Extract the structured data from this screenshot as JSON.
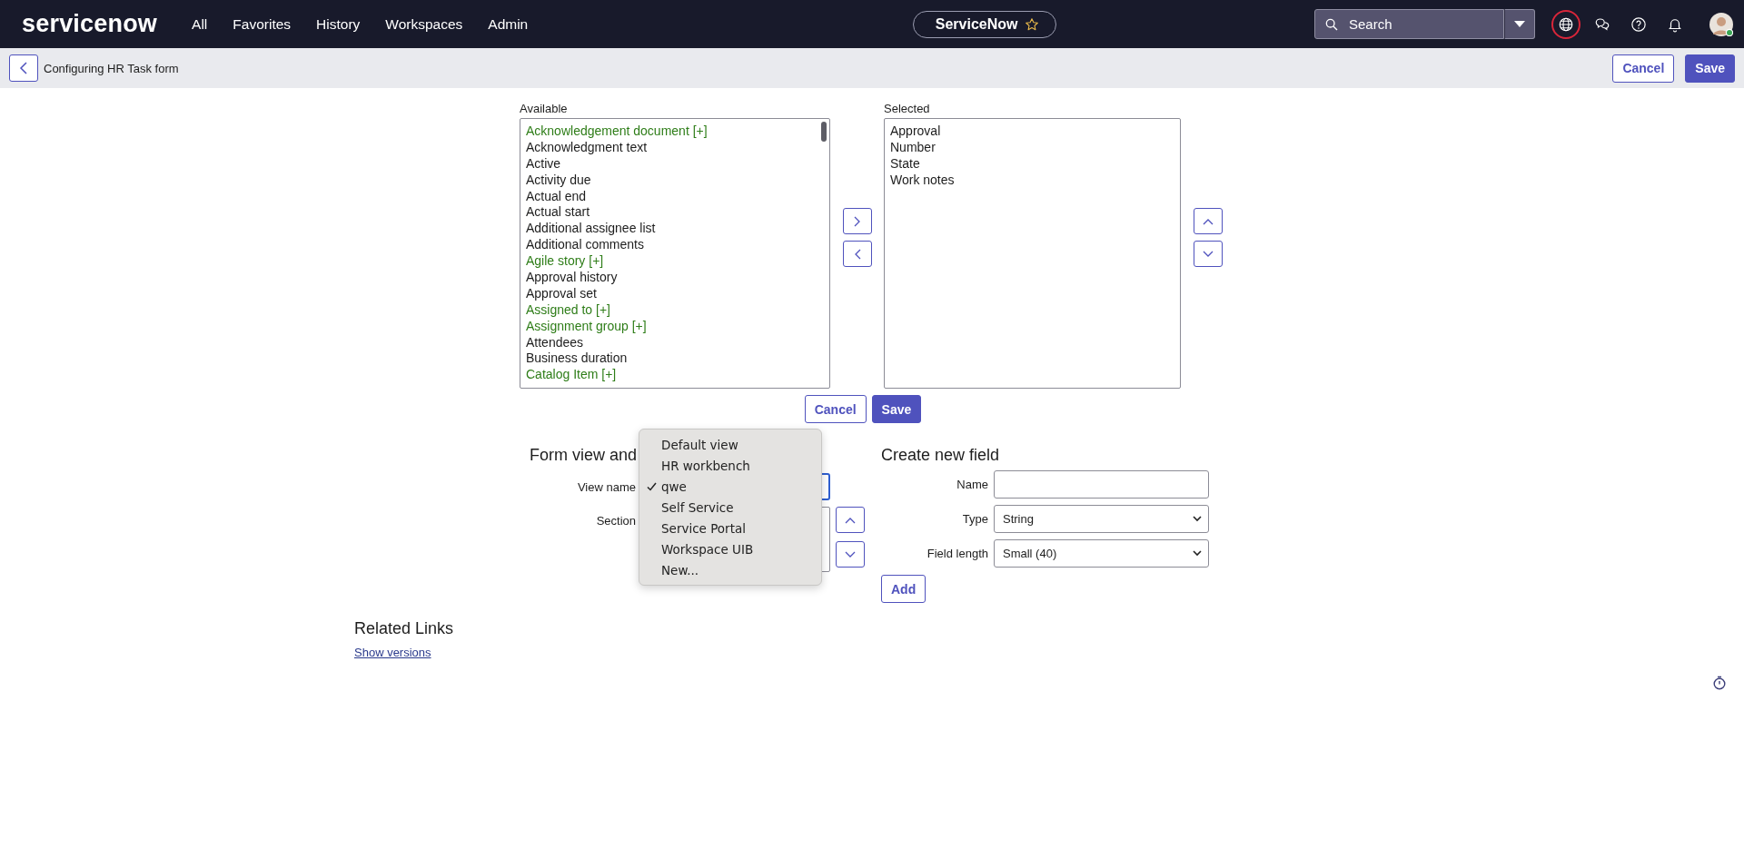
{
  "header": {
    "logo": "servicenow",
    "nav": [
      {
        "label": "All"
      },
      {
        "label": "Favorites"
      },
      {
        "label": "History"
      },
      {
        "label": "Workspaces"
      },
      {
        "label": "Admin"
      }
    ],
    "instance": "ServiceNow",
    "search": {
      "placeholder": "Search"
    }
  },
  "page_bar": {
    "title": "Configuring HR Task form",
    "buttons": [
      "Cancel",
      "Save"
    ]
  },
  "slushbucket": {
    "available_label": "Available",
    "available": [
      {
        "label": "Acknowledgement document [+]",
        "expandable": true
      },
      {
        "label": "Acknowledgment text",
        "expandable": false
      },
      {
        "label": "Active",
        "expandable": false
      },
      {
        "label": "Activity due",
        "expandable": false
      },
      {
        "label": "Actual end",
        "expandable": false
      },
      {
        "label": "Actual start",
        "expandable": false
      },
      {
        "label": "Additional assignee list",
        "expandable": false
      },
      {
        "label": "Additional comments",
        "expandable": false
      },
      {
        "label": "Agile story [+]",
        "expandable": true
      },
      {
        "label": "Approval history",
        "expandable": false
      },
      {
        "label": "Approval set",
        "expandable": false
      },
      {
        "label": "Assigned to [+]",
        "expandable": true
      },
      {
        "label": "Assignment group [+]",
        "expandable": true
      },
      {
        "label": "Attendees",
        "expandable": false
      },
      {
        "label": "Business duration",
        "expandable": false
      },
      {
        "label": "Catalog Item [+]",
        "expandable": true
      }
    ],
    "selected_label": "Selected",
    "selected": [
      "Approval",
      "Number",
      "State",
      "Work notes"
    ],
    "buttons": [
      "Cancel",
      "Save"
    ]
  },
  "form_view": {
    "heading": "Form view and",
    "view_label": "View name",
    "section_label": "Section",
    "view_menu": [
      {
        "label": "Default view",
        "selected": false
      },
      {
        "label": "HR workbench",
        "selected": false
      },
      {
        "label": "qwe",
        "selected": true
      },
      {
        "label": "Self Service",
        "selected": false
      },
      {
        "label": "Service Portal",
        "selected": false
      },
      {
        "label": "Workspace UIB",
        "selected": false
      },
      {
        "label": "New...",
        "selected": false
      }
    ]
  },
  "new_field": {
    "heading": "Create new field",
    "fields": [
      {
        "label": "Name",
        "kind": "text"
      },
      {
        "label": "Type",
        "kind": "select",
        "value": "String"
      },
      {
        "label": "Field length",
        "kind": "select",
        "value": "Small (40)"
      }
    ],
    "button": "Add"
  },
  "related_links": {
    "heading": "Related Links",
    "links": [
      "Show versions"
    ]
  }
}
